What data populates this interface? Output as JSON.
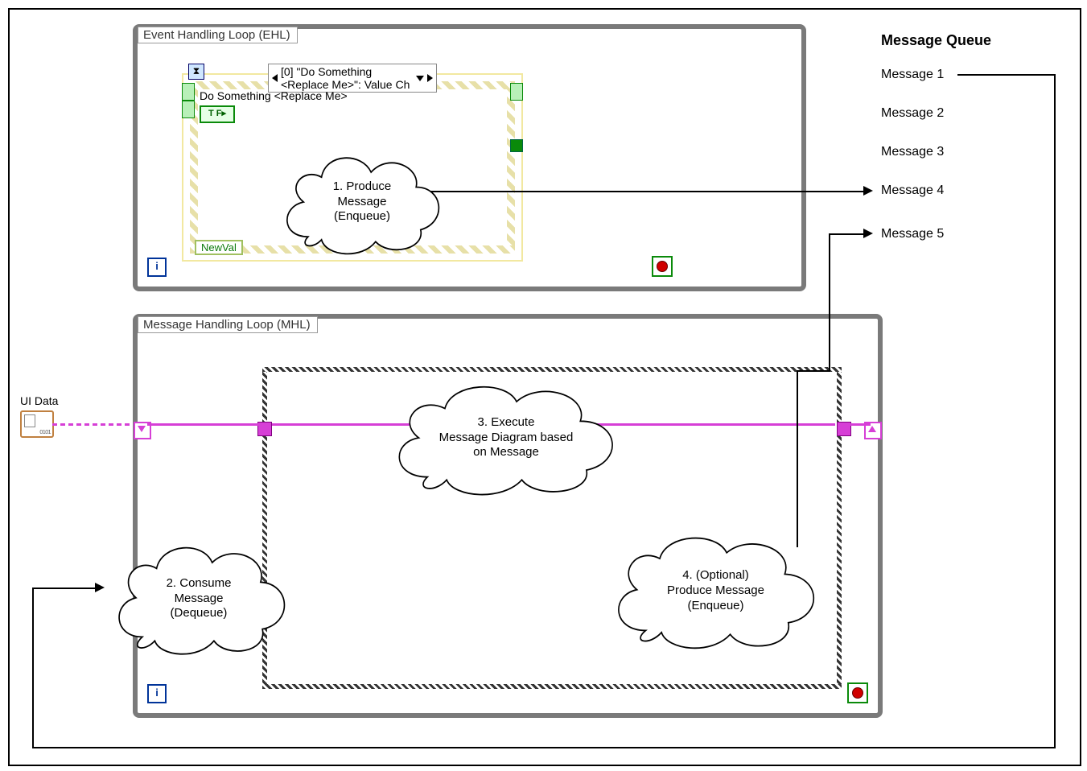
{
  "diagram": {
    "ehl": {
      "title": "Event Handling Loop (EHL)",
      "event_case_label": "[0] \"Do Something <Replace Me>\": Value Ch",
      "event_inner_label": "Do Something <Replace Me>",
      "tf_label": "T F",
      "newval_label": "NewVal",
      "hourglass_icon": "hourglass",
      "i_label": "i"
    },
    "mhl": {
      "title": "Message Handling Loop (MHL)",
      "i_label": "i"
    },
    "ui_data_label": "UI Data"
  },
  "clouds": {
    "c1_line1": "1. Produce",
    "c1_line2": "Message",
    "c1_line3": "(Enqueue)",
    "c2_line1": "2. Consume",
    "c2_line2": "Message",
    "c2_line3": "(Dequeue)",
    "c3_line1": "3. Execute",
    "c3_line2": "Message Diagram based",
    "c3_line3": "on Message",
    "c4_line1": "4. (Optional)",
    "c4_line2": "Produce Message",
    "c4_line3": "(Enqueue)"
  },
  "message_queue": {
    "title": "Message Queue",
    "items": [
      "Message 1",
      "Message 2",
      "Message 3",
      "Message 4",
      "Message 5"
    ]
  }
}
